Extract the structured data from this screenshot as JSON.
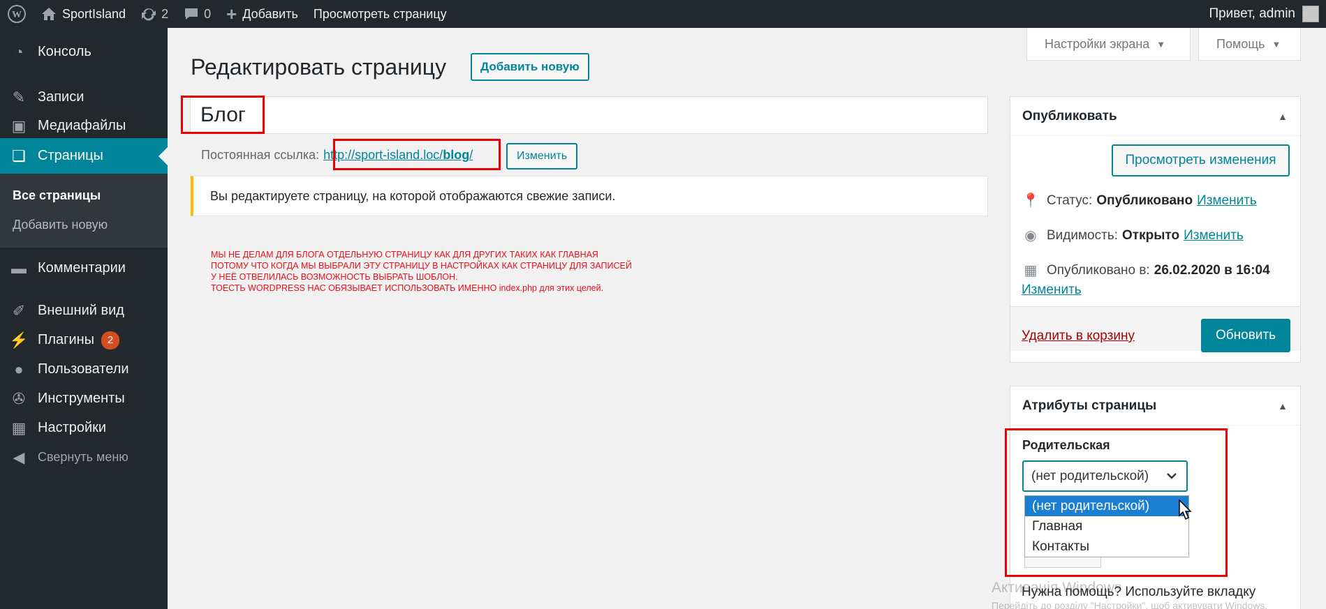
{
  "adminbar": {
    "site_name": "SportIsland",
    "updates_count": "2",
    "comments_count": "0",
    "add_label": "Добавить",
    "view_page_label": "Просмотреть страницу",
    "greeting": "Привет, admin"
  },
  "sidebar": {
    "items": [
      {
        "label": "Консоль",
        "icon": "dashboard-icon"
      },
      {
        "label": "Записи",
        "icon": "pin-icon"
      },
      {
        "label": "Медиафайлы",
        "icon": "media-icon"
      },
      {
        "label": "Страницы",
        "icon": "pages-icon"
      },
      {
        "label": "Комментарии",
        "icon": "comment-icon"
      },
      {
        "label": "Внешний вид",
        "icon": "brush-icon"
      },
      {
        "label": "Плагины",
        "icon": "plugin-icon",
        "badge": "2"
      },
      {
        "label": "Пользователи",
        "icon": "users-icon"
      },
      {
        "label": "Инструменты",
        "icon": "wrench-icon"
      },
      {
        "label": "Настройки",
        "icon": "settings-icon"
      }
    ],
    "submenu": {
      "all_pages": "Все страницы",
      "add_new": "Добавить новую"
    },
    "collapse": "Свернуть меню"
  },
  "screen_meta": {
    "screen_options": "Настройки экрана",
    "help": "Помощь"
  },
  "editor": {
    "heading": "Редактировать страницу",
    "add_new": "Добавить новую",
    "title_value": "Блог",
    "permalink_label": "Постоянная ссылка:",
    "permalink_base": "http://sport-island.loc/",
    "permalink_slug": "blog",
    "permalink_trail": "/",
    "edit_slug": "Изменить",
    "notice": "Вы редактируете страницу, на которой отображаются свежие записи."
  },
  "annotation": {
    "lines": [
      "МЫ НЕ ДЕЛАМ ДЛЯ БЛОГА ОТДЕЛЬНУЮ СТРАНИЦУ КАК ДЛЯ ДРУГИХ ТАКИХ КАК ГЛАВНАЯ",
      "ПОТОМУ ЧТО КОГДА МЫ ВЫБРАЛИ ЭТУ СТРАНИЦУ В НАСТРОЙКАХ КАК СТРАНИЦУ ДЛЯ ЗАПИСЕЙ",
      "У НЕЁ ОТВЕЛИЛАСЬ ВОЗМОЖНОСТЬ ВЫБРАТЬ ШОБЛОН.",
      "ТОЕСТЬ WORDPRESS НАС ОБЯЗЫВАЕТ ИСПОЛЬЗОВАТЬ ИМЕННО index.php для этих целей."
    ]
  },
  "publish": {
    "title": "Опубликовать",
    "preview_changes": "Просмотреть изменения",
    "status_label": "Статус:",
    "status_value": "Опубликовано",
    "visibility_label": "Видимость:",
    "visibility_value": "Открыто",
    "published_label": "Опубликовано в:",
    "published_value": "26.02.2020 в 16:04",
    "edit_link": "Изменить",
    "trash": "Удалить в корзину",
    "update": "Обновить"
  },
  "attributes": {
    "title": "Атрибуты страницы",
    "parent_label": "Родительская",
    "parent_selected": "(нет родительской)",
    "options": [
      "(нет родительской)",
      "Главная",
      "Контакты"
    ],
    "help_text": "Нужна помощь? Используйте вкладку"
  },
  "watermark": {
    "line1": "Активація Windows",
    "line2": "Перейдіть до розділу \"Настройки\", щоб активувати Windows."
  },
  "colors": {
    "accent": "#00859a",
    "annotation": "#e8101a",
    "notice_border": "#ffb900",
    "menu_bg": "#23282d"
  }
}
